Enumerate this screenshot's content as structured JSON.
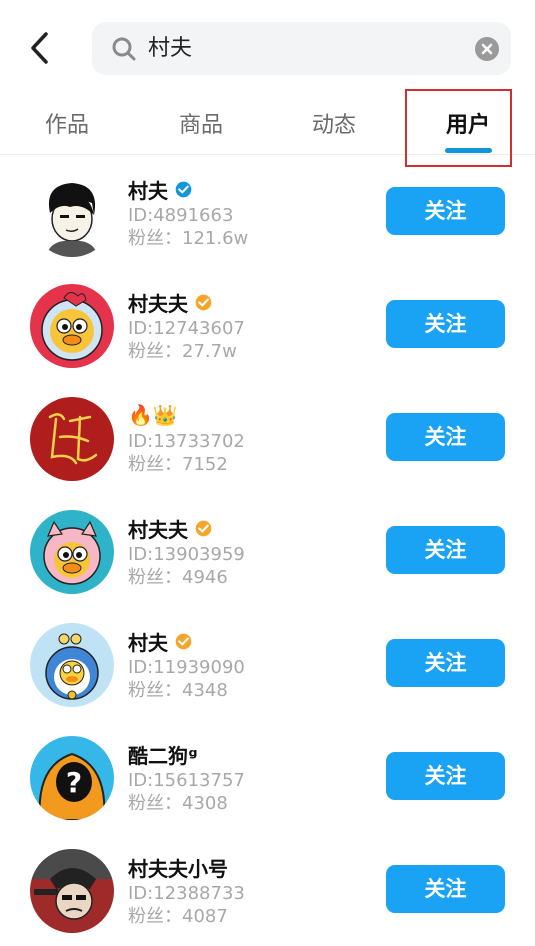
{
  "search": {
    "query": "村夫"
  },
  "tabs": [
    {
      "label": "作品"
    },
    {
      "label": "商品"
    },
    {
      "label": "动态"
    },
    {
      "label": "用户",
      "active": true
    }
  ],
  "colors": {
    "accent": "#1aa3f4",
    "badge_blue": "#1296db",
    "badge_gold": "#f4a62a",
    "highlight": "#d32f2f"
  },
  "users": [
    {
      "name": "村夫",
      "badge": "blue-verified-icon",
      "id": "ID:4891663",
      "fans": "粉丝：121.6w",
      "follow": "关注"
    },
    {
      "name": "村夫夫",
      "badge": "gold-verified-icon",
      "id": "ID:12743607",
      "fans": "粉丝：27.7w",
      "follow": "关注"
    },
    {
      "name": "🔥👑",
      "badge": "",
      "id": "ID:13733702",
      "fans": "粉丝：7152",
      "follow": "关注"
    },
    {
      "name": "村夫夫",
      "badge": "gold-verified-icon",
      "id": "ID:13903959",
      "fans": "粉丝：4946",
      "follow": "关注"
    },
    {
      "name": "村夫",
      "badge": "gold-verified-icon",
      "id": "ID:11939090",
      "fans": "粉丝：4348",
      "follow": "关注"
    },
    {
      "name": "酷二狗ᵍ",
      "badge": "",
      "id": "ID:15613757",
      "fans": "粉丝：4308",
      "follow": "关注"
    },
    {
      "name": "村夫夫小号",
      "badge": "",
      "id": "ID:12388733",
      "fans": "粉丝：4087",
      "follow": "关注"
    }
  ]
}
